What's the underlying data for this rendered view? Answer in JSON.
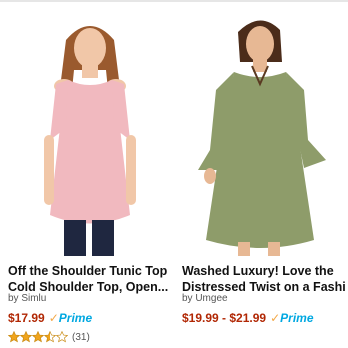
{
  "products": [
    {
      "title_line1": "Off the Shoulder Tunic Top",
      "title_line2": "Cold Shoulder Top, Open...",
      "brand": "by Simlu",
      "price": "$17.99",
      "prime_label": "Prime",
      "rating": 3.5,
      "rating_max": 5,
      "review_count": "(31)",
      "image_icon": "pink-cold-shoulder-tunic-photo"
    },
    {
      "title_line1": "Washed Luxury! Love the",
      "title_line2": "Distressed Twist on a Fashi...",
      "brand": "by Umgee",
      "price": "$19.99 - $21.99",
      "prime_label": "Prime",
      "image_icon": "olive-bell-sleeve-dress-photo"
    }
  ],
  "colors": {
    "price": "#b12704",
    "prime_blue": "#00a8e1",
    "prime_check": "#f3a847",
    "star": "#f0a41c"
  }
}
